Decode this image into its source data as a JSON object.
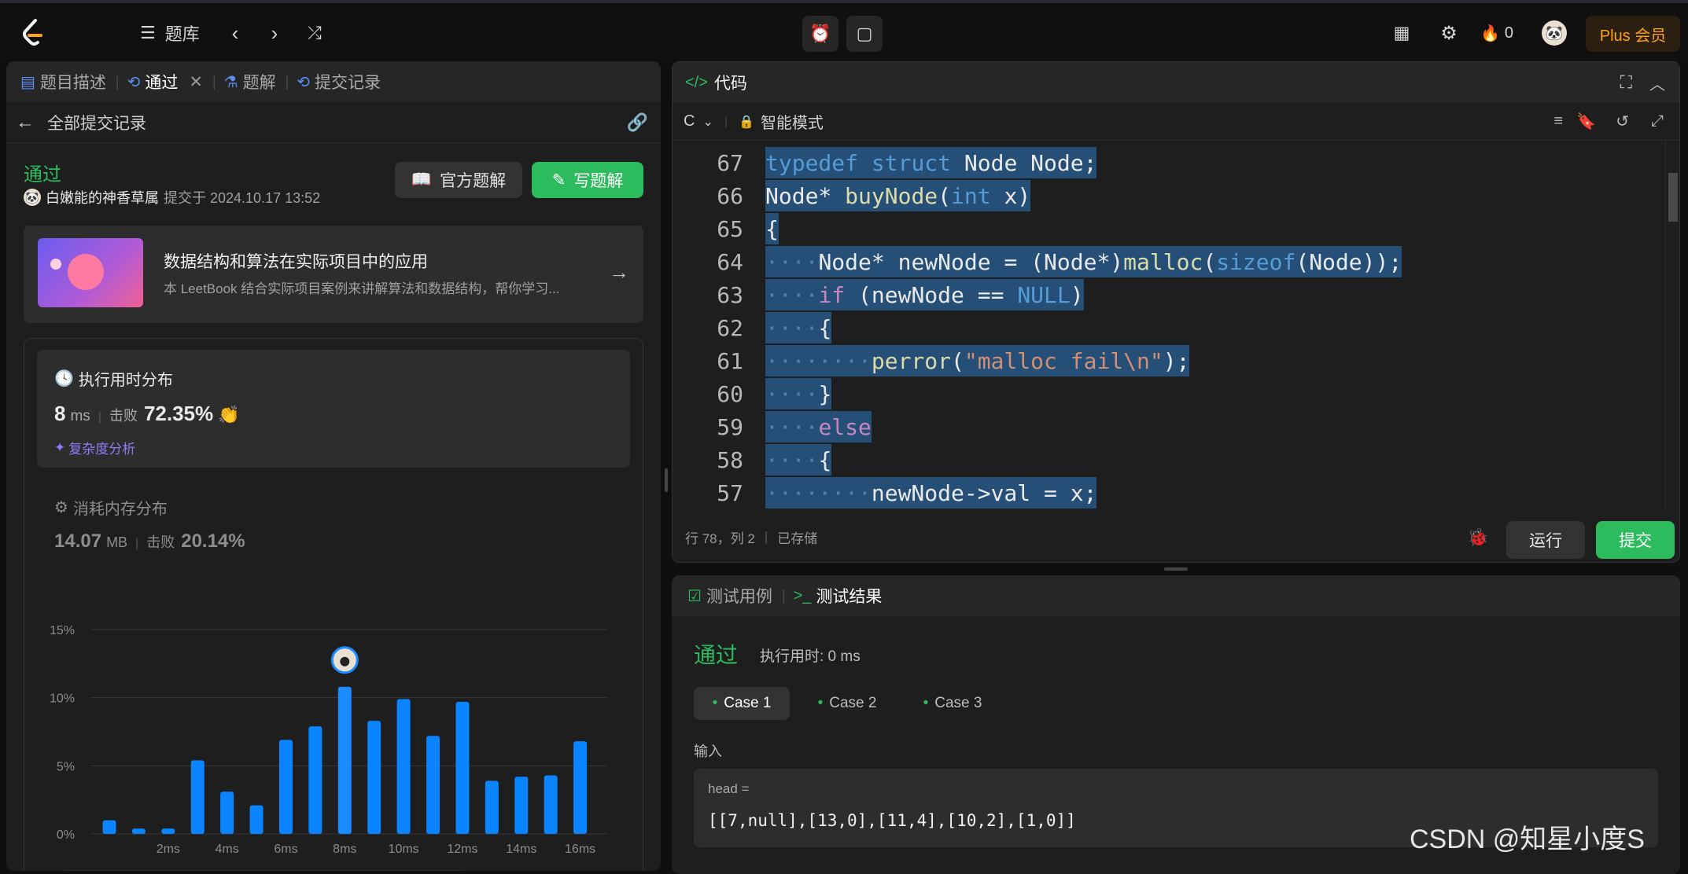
{
  "nav": {
    "title": "题库",
    "badge_count": "0",
    "plus_label": "Plus 会员"
  },
  "left_tabs": [
    {
      "label": "题目描述"
    },
    {
      "label": "通过"
    },
    {
      "label": "题解"
    },
    {
      "label": "提交记录"
    }
  ],
  "submission": {
    "back_label": "全部提交记录",
    "status": "通过",
    "user": "白嫩能的神香草属",
    "submitted_at": "提交于 2024.10.17 13:52",
    "official_button": "官方题解",
    "write_button": "写题解"
  },
  "leetbook": {
    "title": "数据结构和算法在实际项目中的应用",
    "desc": "本 LeetBook 结合实际项目案例来讲解算法和数据结构，帮你学习..."
  },
  "runtime": {
    "heading": "执行用时分布",
    "value": "8",
    "unit": "ms",
    "beat_label": "击败",
    "beat_value": "72.35%",
    "analysis_link": "复杂度分析"
  },
  "memory": {
    "heading": "消耗内存分布",
    "value": "14.07",
    "unit": "MB",
    "beat_label": "击败",
    "beat_value": "20.14%"
  },
  "chart_data": {
    "type": "bar",
    "title": "",
    "xlabel": "",
    "ylabel": "",
    "ylim": [
      0,
      15
    ],
    "yticks": [
      "0%",
      "5%",
      "10%",
      "15%"
    ],
    "xticks": [
      "2ms",
      "4ms",
      "6ms",
      "8ms",
      "10ms",
      "12ms",
      "14ms",
      "16ms"
    ],
    "categories": [
      "1ms",
      "1.5ms",
      "2ms",
      "3ms",
      "4ms",
      "5ms",
      "6ms",
      "7ms",
      "8ms",
      "9ms",
      "10ms",
      "11ms",
      "12ms",
      "13ms",
      "14ms",
      "15ms",
      "16ms"
    ],
    "values": [
      1.0,
      0.4,
      0.4,
      5.4,
      3.1,
      2.1,
      6.9,
      7.9,
      10.8,
      8.3,
      9.9,
      7.2,
      9.7,
      3.9,
      4.2,
      4.3,
      6.8
    ],
    "highlight_index": 8,
    "bar_color": "#0a84ff",
    "grid": true
  },
  "editor": {
    "title": "代码",
    "language": "C",
    "mode": "智能模式",
    "status_pos": "行 78，列 2",
    "status_saved": "已存储",
    "run_label": "运行",
    "submit_label": "提交",
    "lines": [
      {
        "no": "67",
        "indent": "",
        "code": [
          {
            "t": "typedef",
            "c": "kw"
          },
          {
            "t": " ",
            "c": "tp"
          },
          {
            "t": "struct",
            "c": "kw"
          },
          {
            "t": " Node Node;",
            "c": "tp"
          }
        ]
      },
      {
        "no": "66",
        "indent": "",
        "code": [
          {
            "t": "Node* ",
            "c": "tp"
          },
          {
            "t": "buyNode",
            "c": "fn"
          },
          {
            "t": "(",
            "c": "tp"
          },
          {
            "t": "int",
            "c": "kw"
          },
          {
            "t": " x)",
            "c": "tp"
          }
        ]
      },
      {
        "no": "65",
        "indent": "",
        "code": [
          {
            "t": "{",
            "c": "tp"
          }
        ]
      },
      {
        "no": "64",
        "indent": "····",
        "code": [
          {
            "t": "Node* newNode = (Node*)",
            "c": "tp"
          },
          {
            "t": "malloc",
            "c": "fn"
          },
          {
            "t": "(",
            "c": "tp"
          },
          {
            "t": "sizeof",
            "c": "kw"
          },
          {
            "t": "(Node));",
            "c": "tp"
          }
        ]
      },
      {
        "no": "63",
        "indent": "····",
        "code": [
          {
            "t": "if",
            "c": "kw2"
          },
          {
            "t": " (newNode == ",
            "c": "tp"
          },
          {
            "t": "NULL",
            "c": "kw"
          },
          {
            "t": ")",
            "c": "tp"
          }
        ]
      },
      {
        "no": "62",
        "indent": "····",
        "code": [
          {
            "t": "{",
            "c": "tp"
          }
        ]
      },
      {
        "no": "61",
        "indent": "········",
        "code": [
          {
            "t": "perror",
            "c": "fn"
          },
          {
            "t": "(",
            "c": "tp"
          },
          {
            "t": "\"malloc fail\\n\"",
            "c": "str"
          },
          {
            "t": ");",
            "c": "tp"
          }
        ]
      },
      {
        "no": "60",
        "indent": "····",
        "code": [
          {
            "t": "}",
            "c": "tp"
          }
        ]
      },
      {
        "no": "59",
        "indent": "····",
        "code": [
          {
            "t": "else",
            "c": "kw2"
          }
        ]
      },
      {
        "no": "58",
        "indent": "····",
        "code": [
          {
            "t": "{",
            "c": "tp"
          }
        ]
      },
      {
        "no": "57",
        "indent": "········",
        "code": [
          {
            "t": "newNode->val = x;",
            "c": "tp"
          }
        ]
      }
    ]
  },
  "testpanel": {
    "tab_cases": "测试用例",
    "tab_result": "测试结果",
    "status": "通过",
    "runtime": "执行用时: 0 ms",
    "cases": [
      "Case 1",
      "Case 2",
      "Case 3"
    ],
    "input_label": "输入",
    "param_name": "head =",
    "param_value": "[[7,null],[13,0],[11,4],[10,2],[1,0]]"
  },
  "watermark": "CSDN @知星小度S"
}
